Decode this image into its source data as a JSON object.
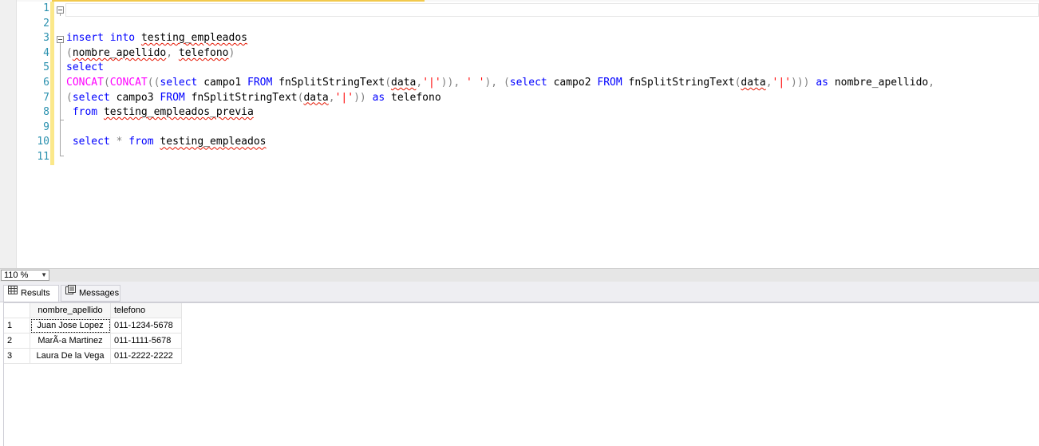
{
  "editor": {
    "line_numbers": [
      "1",
      "2",
      "3",
      "4",
      "5",
      "6",
      "7",
      "8",
      "9",
      "10",
      "11"
    ]
  },
  "zoom": {
    "value": "110 %"
  },
  "tabs": {
    "results_label": "Results",
    "messages_label": "Messages"
  },
  "grid": {
    "columns": [
      "nombre_apellido",
      "telefono"
    ],
    "rows": [
      {
        "num": "1",
        "nombre_apellido": "Juan Jose Lopez",
        "telefono": "011-1234-5678"
      },
      {
        "num": "2",
        "nombre_apellido": "MarÃ-a Martinez",
        "telefono": "011-1111-5678"
      },
      {
        "num": "3",
        "nombre_apellido": "Laura De la Vega",
        "telefono": "011-2222-2222"
      }
    ]
  },
  "code_tokens": {
    "l3": [
      "insert",
      "into",
      "testing_empleados"
    ],
    "l4": [
      "(",
      "nombre_apellido",
      ",",
      "telefono",
      ")"
    ],
    "l5": [
      "select"
    ],
    "l6": [
      "CONCAT",
      "(",
      "CONCAT",
      "((",
      "select",
      "campo1",
      "FROM",
      "fnSplitStringText",
      "(",
      "data",
      ",",
      "'|'",
      "))",
      ",",
      "' '",
      "),",
      "(",
      "select",
      "campo2",
      "FROM",
      "fnSplitStringText",
      "(",
      "data",
      ",",
      "'|'",
      ")))",
      "as",
      "nombre_apellido",
      ","
    ],
    "l7": [
      "(",
      "select",
      "campo3",
      "FROM",
      "fnSplitStringText",
      "(",
      "data",
      ",",
      "'|'",
      "))",
      "as",
      "telefono"
    ],
    "l8": [
      "from",
      "testing_empleados_previa"
    ],
    "l10": [
      "select",
      "*",
      "from",
      "testing_empleados"
    ]
  },
  "colors": {
    "keyword": "#0000ff",
    "function": "#ff00ff",
    "operator": "#808080",
    "string": "#ff0000",
    "line_number": "#2b91af",
    "squiggle": "#e51400"
  }
}
